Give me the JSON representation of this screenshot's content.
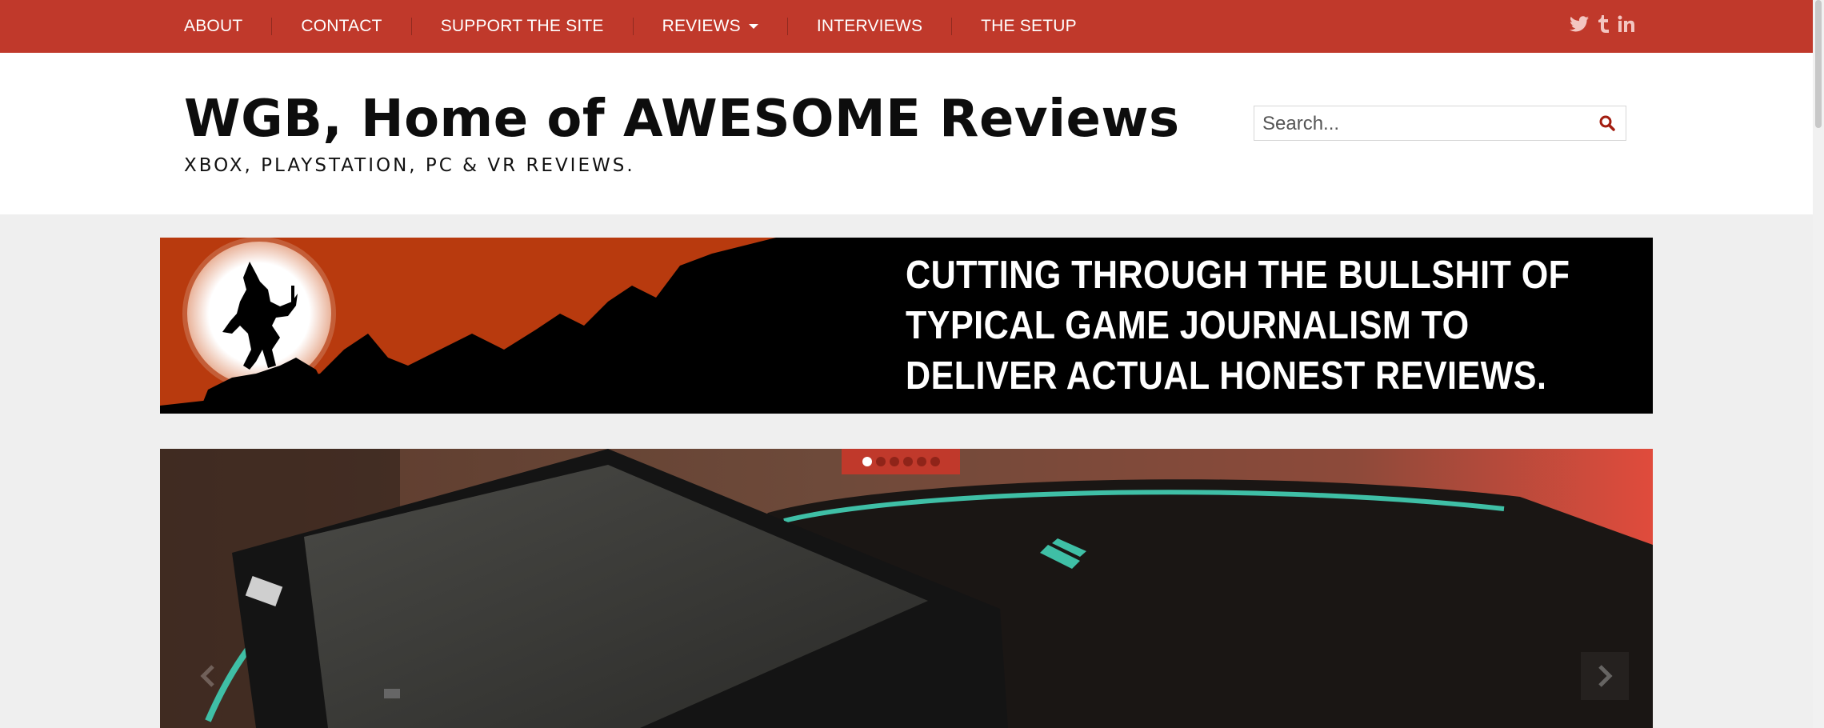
{
  "nav": {
    "items": [
      {
        "label": "ABOUT"
      },
      {
        "label": "CONTACT"
      },
      {
        "label": "SUPPORT THE SITE"
      },
      {
        "label": "REVIEWS"
      },
      {
        "label": "INTERVIEWS"
      },
      {
        "label": "THE SETUP"
      }
    ],
    "social_icons": [
      "twitter-icon",
      "tumblr-icon",
      "linkedin-icon"
    ],
    "social_glyphs": {
      "twitter": "🐦",
      "tumblr": "t",
      "linkedin": "in"
    }
  },
  "header": {
    "title": "WGB, Home of AWESOME Reviews",
    "tagline": "XBOX, PLAYSTATION, PC & VR REVIEWS."
  },
  "search": {
    "placeholder": "Search..."
  },
  "banner": {
    "line1": "CUTTING THROUGH THE BULLSHIT OF",
    "line2": "TYPICAL GAME JOURNALISM TO",
    "line3": "DELIVER ACTUAL HONEST REVIEWS."
  },
  "slider": {
    "slide_count": 6,
    "active_index": 0
  },
  "colors": {
    "brand_red": "#c0392b",
    "banner_orange": "#b83a0e",
    "text_dark": "#0d0d0d"
  }
}
